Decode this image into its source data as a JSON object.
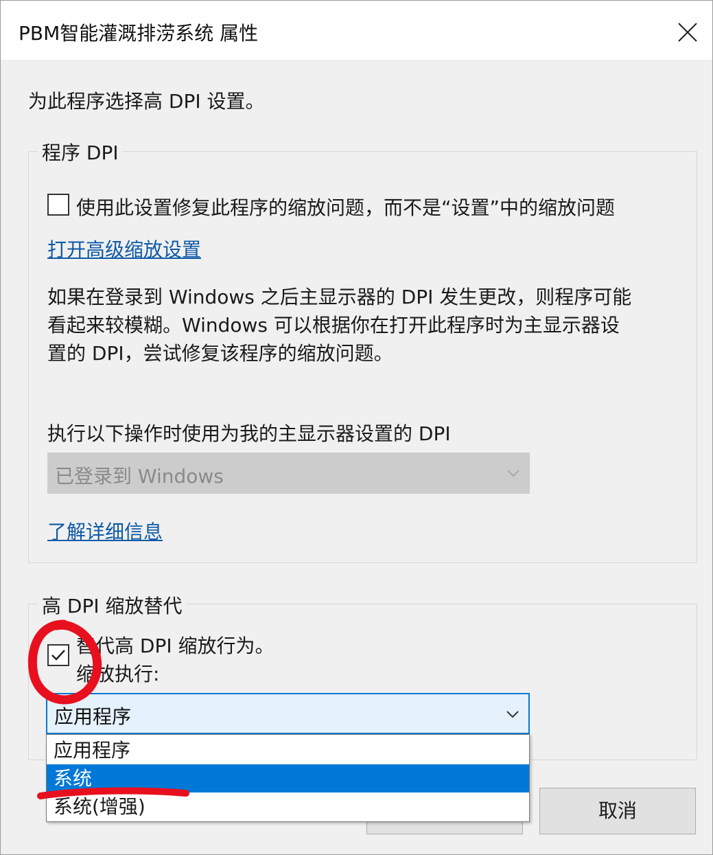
{
  "window": {
    "title": "PBM智能灌溉排涝系统 属性"
  },
  "intro": "为此程序选择高 DPI 设置。",
  "program_dpi": {
    "legend": "程序 DPI",
    "checkbox_label": "使用此设置修复此程序的缩放问题，而不是“设置”中的缩放问题",
    "checkbox_checked": false,
    "advanced_link": "打开高级缩放设置",
    "description_lines": [
      "如果在登录到 Windows 之后主显示器的 DPI 发生更改，则程序可能",
      "看起来较模糊。Windows 可以根据你在打开此程序时为主显示器设",
      "置的 DPI，尝试修复该程序的缩放问题。"
    ],
    "select_label": "执行以下操作时使用为我的主显示器设置的 DPI",
    "select_value": "已登录到 Windows",
    "learn_more_link": "了解详细信息"
  },
  "high_dpi_override": {
    "legend": "高 DPI 缩放替代",
    "checkbox_label": "替代高 DPI 缩放行为。",
    "checkbox_checked": true,
    "scaling_label": "缩放执行:",
    "select_value": "应用程序",
    "options": [
      "应用程序",
      "系统",
      "系统(增强)"
    ],
    "highlighted_option": "系统"
  },
  "buttons": {
    "cancel": "取消"
  },
  "colors": {
    "accent": "#0078d7",
    "link": "#0e5aa7",
    "annotation": "#e8101e"
  }
}
